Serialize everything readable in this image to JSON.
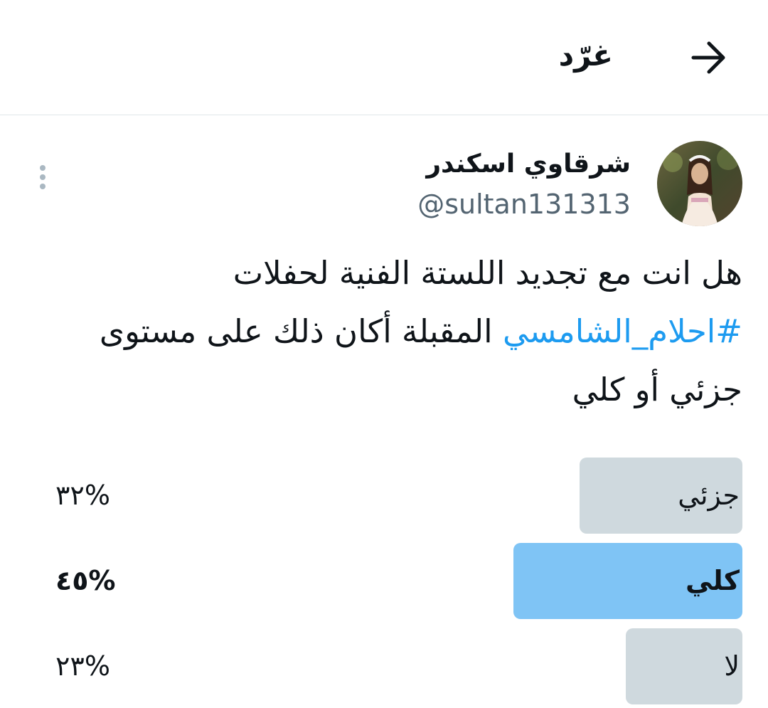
{
  "header": {
    "title": "غرّد",
    "back_icon": "arrow-right-icon"
  },
  "tweet": {
    "author": {
      "name": "شرقاوي اسكندر",
      "handle": "@sultan131313"
    },
    "text_part1": "هل انت مع تجديد اللستة الفنية لحفلات",
    "hashtag": "#احلام_الشامسي",
    "text_part2": "المقبلة أكان ذلك على مستوى جزئي أو كلي",
    "more_icon": "more-vertical-icon"
  },
  "poll": {
    "options": [
      {
        "label": "جزئي",
        "percent_text": "%٣٢",
        "value": 0.32,
        "winner": false
      },
      {
        "label": "كلي",
        "percent_text": "%٤٥",
        "value": 0.45,
        "winner": true
      },
      {
        "label": "لا",
        "percent_text": "%٢٣",
        "value": 0.23,
        "winner": false
      }
    ]
  },
  "colors": {
    "accent": "#1d9bf0",
    "winner_bar": "#7fc4f5",
    "other_bar": "#cfd9de",
    "secondary_text": "#536471"
  }
}
